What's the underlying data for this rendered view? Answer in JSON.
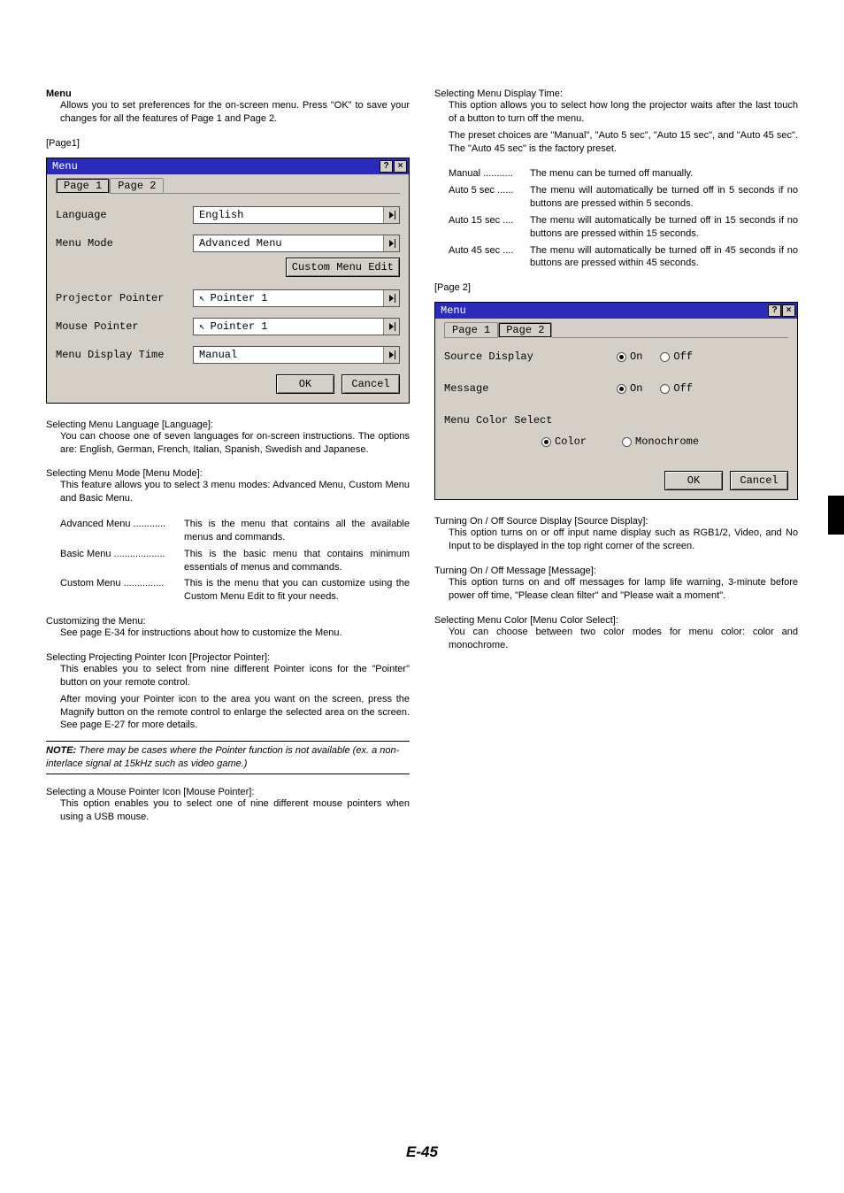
{
  "left": {
    "heading_menu": "Menu",
    "menu_desc": "Allows you to set preferences for the on-screen menu. Press \"OK\" to save your changes for all the features of Page 1 and Page 2.",
    "page1_label": "[Page1]",
    "dialog1": {
      "title": "Menu",
      "tab1": "Page 1",
      "tab2": "Page 2",
      "row_language_lab": "Language",
      "row_language_val": "English",
      "row_menumode_lab": "Menu Mode",
      "row_menumode_val": "Advanced Menu",
      "custom_menu_edit": "Custom Menu Edit",
      "row_projptr_lab": "Projector Pointer",
      "row_projptr_val": "Pointer 1",
      "row_mouseptr_lab": "Mouse Pointer",
      "row_mouseptr_val": "Pointer 1",
      "row_mdtime_lab": "Menu Display Time",
      "row_mdtime_val": "Manual",
      "ok": "OK",
      "cancel": "Cancel"
    },
    "sel_lang_head": "Selecting Menu Language [Language]:",
    "sel_lang_body": "You can choose one of seven languages for on-screen instructions. The options are: English, German, French, Italian, Spanish, Swedish and Japanese.",
    "sel_mode_head": "Selecting Menu Mode [Menu Mode]:",
    "sel_mode_body": "This feature allows you to select 3 menu modes: Advanced Menu, Custom Menu and Basic Menu.",
    "mm_adv_t": "Advanced Menu ............",
    "mm_adv_d": "This is the menu that contains all the available menus and commands.",
    "mm_bas_t": "Basic Menu ...................",
    "mm_bas_d": "This is the basic menu that contains minimum essentials of menus and commands.",
    "mm_cus_t": "Custom Menu ...............",
    "mm_cus_d": "This is the menu that you can customize using the Custom Menu Edit to fit your needs.",
    "cust_head": "Customizing the Menu:",
    "cust_body": "See page E-34 for instructions about how to customize the Menu.",
    "projptr_head": "Selecting Projecting Pointer Icon [Projector Pointer]:",
    "projptr_b1": "This enables you to select from nine different Pointer icons for the \"Pointer\" button on your remote control.",
    "projptr_b2": "After moving your Pointer icon to the area you want on the screen, press the Magnify button on the remote control to enlarge the selected area on the screen. See page E-27 for more details.",
    "note_label": "NOTE:",
    "note_body": " There may be cases where the Pointer function is not available (ex. a non-interlace signal at 15kHz such as video game.)",
    "mouseptr_head": "Selecting a Mouse Pointer Icon [Mouse Pointer]:",
    "mouseptr_body": "This option enables you to select one of nine different mouse pointers when using a USB mouse."
  },
  "right": {
    "mdtime_head": "Selecting Menu Display Time:",
    "mdtime_b1": "This option allows you to select how long the projector waits after the last touch of a button to turn off the menu.",
    "mdtime_b2": "The preset choices are \"Manual\", \"Auto 5 sec\", \"Auto 15 sec\", and \"Auto 45 sec\". The \"Auto 45 sec\" is the factory preset.",
    "dt_man_t": "Manual ...........",
    "dt_man_d": "The menu can be turned off manually.",
    "dt_5_t": "Auto 5 sec ......",
    "dt_5_d": "The menu will automatically be turned off in 5 seconds if no buttons are pressed within 5 seconds.",
    "dt_15_t": "Auto 15 sec ....",
    "dt_15_d": "The menu will automatically be turned off in 15 seconds if no buttons are pressed within 15 seconds.",
    "dt_45_t": "Auto 45 sec ....",
    "dt_45_d": "The menu will automatically be turned off in 45 seconds if no buttons are pressed within 45 seconds.",
    "page2_label": "[Page 2]",
    "dialog2": {
      "title": "Menu",
      "tab1": "Page 1",
      "tab2": "Page 2",
      "row_srcdisp_lab": "Source Display",
      "on": "On",
      "off": "Off",
      "row_msg_lab": "Message",
      "row_mcolor_lab": "Menu Color Select",
      "color": "Color",
      "mono": "Monochrome",
      "ok": "OK",
      "cancel": "Cancel"
    },
    "srcdisp_head": "Turning On / Off Source Display [Source Display]:",
    "srcdisp_body": "This option turns on or off input name display such as RGB1/2, Video, and No Input to be displayed in the top right corner of the screen.",
    "msg_head": "Turning On / Off Message [Message]:",
    "msg_body": "This option turns on and off messages for lamp life warning, 3-minute before power off time, \"Please clean filter\" and \"Please wait a moment\".",
    "mcolor_head": "Selecting Menu Color [Menu Color Select]:",
    "mcolor_body": "You can choose between two color modes for menu color: color and monochrome."
  },
  "page_number": "E-45"
}
